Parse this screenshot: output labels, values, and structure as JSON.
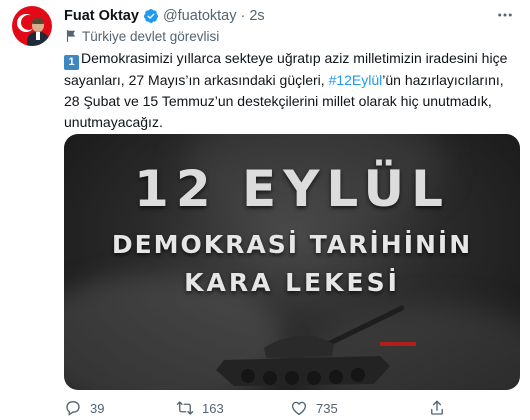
{
  "author": {
    "name": "Fuat Oktay",
    "handle": "@fuatoktay",
    "separator": "·",
    "time": "2s",
    "label": "Türkiye devlet görevlisi"
  },
  "tweet": {
    "emoji": "1",
    "text_part1": "Demokrasimizi yıllarca sekteye uğratıp aziz milletimizin iradesini hiçe sayanları, 27 Mayıs’ın arkasındaki güçleri, ",
    "hashtag": "#12Eylül",
    "text_part2": "’ün hazırlayıcılarını, 28 Şubat ve 15 Temmuz’un destekçilerini millet olarak hiç unutmadık, unutmayacağız."
  },
  "media": {
    "line1": "12 EYLÜL",
    "line2": "DEMOKRASİ TARİHİNİN",
    "line3": "KARA LEKESİ"
  },
  "actions": {
    "replies": "39",
    "retweets": "163",
    "likes": "735"
  },
  "colors": {
    "accent": "#1d9bf0",
    "secondary_text": "#536471"
  }
}
